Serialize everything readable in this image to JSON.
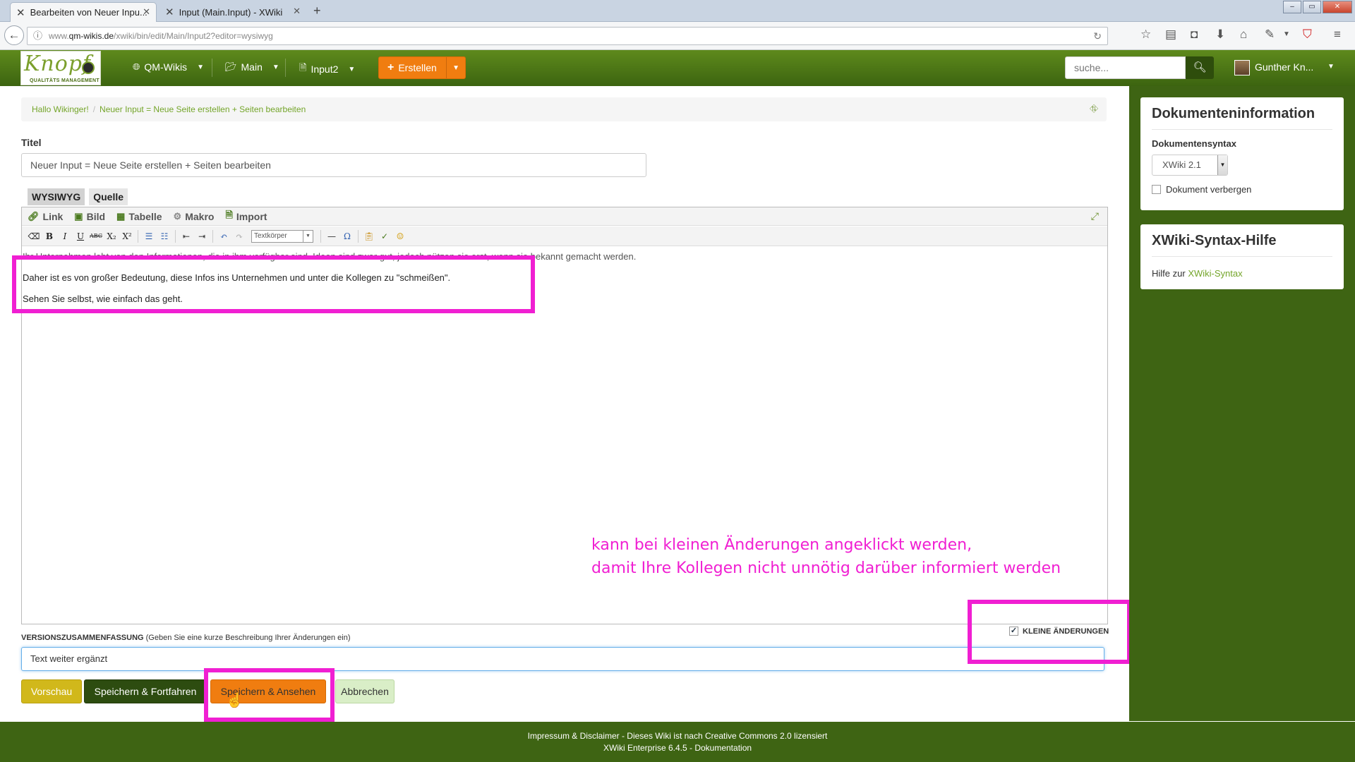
{
  "browser": {
    "tabs": [
      {
        "title": "Bearbeiten von Neuer Inpu..."
      },
      {
        "title": "Input (Main.Input) - XWiki"
      }
    ],
    "new_tab": "+",
    "url_prefix": "www.",
    "url_domain": "qm-wikis.de",
    "url_path": "/xwiki/bin/edit/Main/Input2?editor=wysiwyg",
    "window_controls": [
      "–",
      "▭",
      "✕"
    ]
  },
  "header": {
    "logo_word": "Knopf",
    "logo_sub": "QUALITÄTS MANAGEMENT",
    "menus": [
      {
        "label": "QM-Wikis",
        "icon": "globe-icon"
      },
      {
        "label": "Main",
        "icon": "folder-icon"
      },
      {
        "label": "Input2",
        "icon": "document-icon"
      }
    ],
    "create_label": "Erstellen",
    "search_placeholder": "suche...",
    "user_name": "Gunther Kn..."
  },
  "breadcrumb": {
    "items": [
      "Hallo Wikinger!",
      "Neuer Input = Neue Seite erstellen + Seiten bearbeiten"
    ],
    "separator": "/"
  },
  "form": {
    "title_label": "Titel",
    "title_value": "Neuer Input = Neue Seite erstellen + Seiten bearbeiten",
    "editor_tabs": [
      "WYSIWYG",
      "Quelle"
    ],
    "toolbar1": [
      {
        "label": "Link",
        "icon": "link-icon"
      },
      {
        "label": "Bild",
        "icon": "image-icon"
      },
      {
        "label": "Tabelle",
        "icon": "table-icon"
      },
      {
        "label": "Makro",
        "icon": "macro-gear-icon"
      },
      {
        "label": "Import",
        "icon": "import-icon"
      }
    ],
    "format_select": "Textkörper",
    "content": [
      "Ihr Unternehmen lebt von den Informationen, die in ihm verfügbar sind. Ideen sind zwar gut, jedoch nützen sie erst, wenn sie bekannt gemacht werden.",
      "Daher ist es von großer Bedeutung, diese Infos ins Unternehmen und unter die Kollegen zu \"schmeißen\".",
      "Sehen Sie selbst, wie einfach das geht."
    ],
    "version_label": "VERSIONSZUSAMMENFASSUNG",
    "version_hint": "(Geben Sie eine kurze Beschreibung Ihrer Änderungen ein)",
    "version_value": "Text weiter ergänzt",
    "minor_edit_label": "KLEINE ÄNDERUNGEN",
    "minor_edit_checked": true,
    "buttons": {
      "preview": "Vorschau",
      "save_continue": "Speichern & Fortfahren",
      "save_view": "Speichern & Ansehen",
      "cancel": "Abbrechen"
    }
  },
  "annotation": {
    "line1": "kann bei kleinen Änderungen angeklickt werden,",
    "line2": "damit Ihre Kollegen nicht unnötig darüber informiert werden",
    "color": "#f01fd2"
  },
  "sidebar": {
    "docinfo_title": "Dokumenteninformation",
    "syntax_label": "Dokumentensyntax",
    "syntax_value": "XWiki 2.1",
    "hide_doc_label": "Dokument verbergen",
    "help_title": "XWiki-Syntax-Hilfe",
    "help_prefix": "Hilfe zur",
    "help_link": "XWiki-Syntax"
  },
  "footer": {
    "line1": "Impressum & Disclaimer - Dieses Wiki ist nach Creative Commons 2.0 lizensiert",
    "line2": "XWiki Enterprise 6.4.5 - Dokumentation"
  },
  "colors": {
    "brand_green": "#3e6413",
    "accent_orange": "#f07d10",
    "link_green": "#74a52a"
  }
}
